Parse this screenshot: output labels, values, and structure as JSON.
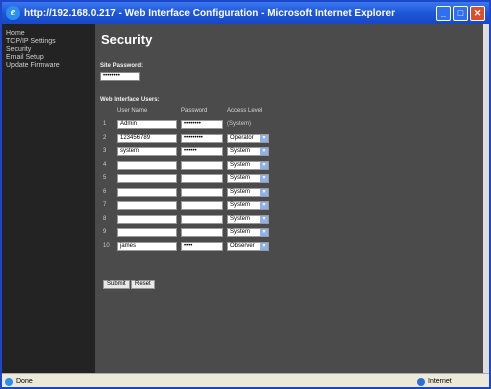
{
  "window": {
    "title": "http://192.168.0.217 - Web Interface Configuration - Microsoft Internet Explorer"
  },
  "sidebar": {
    "items": [
      {
        "label": "Home"
      },
      {
        "label": "TCP/IP Settings"
      },
      {
        "label": "Security"
      },
      {
        "label": "Email Setup"
      },
      {
        "label": "Update Firmware"
      }
    ]
  },
  "main": {
    "title": "Security",
    "site_password_label": "Site Password:",
    "site_password_value": "••••••••",
    "users_label": "Web Interface Users:",
    "columns": {
      "user": "User Name",
      "password": "Password",
      "access": "Access Level"
    },
    "rows": [
      {
        "num": "1",
        "user": "Admin",
        "password": "••••••••",
        "access": "(System)",
        "editable_access": false
      },
      {
        "num": "2",
        "user": "123456789",
        "password": "•••••••••",
        "access": "Operator",
        "editable_access": true
      },
      {
        "num": "3",
        "user": "system",
        "password": "••••••",
        "access": "System",
        "editable_access": true
      },
      {
        "num": "4",
        "user": "",
        "password": "",
        "access": "System",
        "editable_access": true
      },
      {
        "num": "5",
        "user": "",
        "password": "",
        "access": "System",
        "editable_access": true
      },
      {
        "num": "6",
        "user": "",
        "password": "",
        "access": "System",
        "editable_access": true
      },
      {
        "num": "7",
        "user": "",
        "password": "",
        "access": "System",
        "editable_access": true
      },
      {
        "num": "8",
        "user": "",
        "password": "",
        "access": "System",
        "editable_access": true
      },
      {
        "num": "9",
        "user": "",
        "password": "",
        "access": "System",
        "editable_access": true
      },
      {
        "num": "10",
        "user": "james",
        "password": "••••",
        "access": "Observer",
        "editable_access": true
      }
    ],
    "submit_label": "Submit",
    "reset_label": "Reset"
  },
  "statusbar": {
    "left": "Done",
    "zone": "Internet"
  }
}
